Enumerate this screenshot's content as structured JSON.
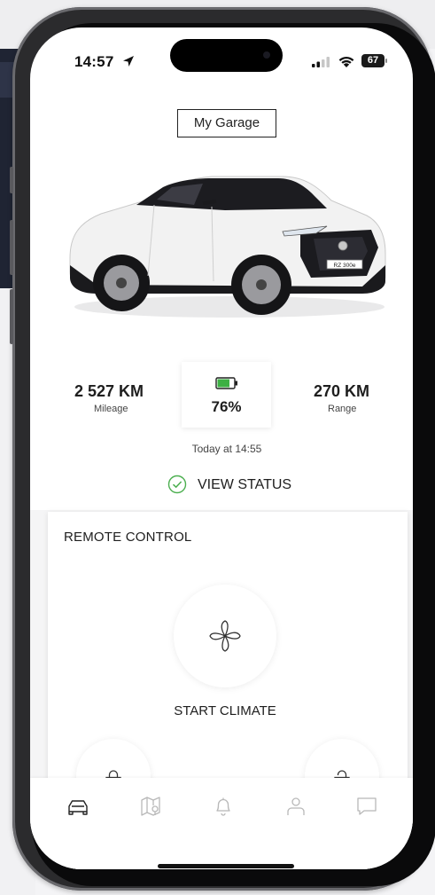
{
  "status_bar": {
    "time": "14:57",
    "battery_level": "67",
    "icons": [
      "location-arrow-icon",
      "signal-icon",
      "wifi-icon",
      "battery-icon"
    ]
  },
  "header": {
    "garage_button_label": "My Garage"
  },
  "vehicle": {
    "mileage_value": "2 527 KM",
    "mileage_label": "Mileage",
    "battery_percent": "76%",
    "range_value": "270 KM",
    "range_label": "Range",
    "updated": "Today at 14:55",
    "view_status_label": "VIEW STATUS",
    "plate": "RZ 300e"
  },
  "remote_control": {
    "title": "REMOTE CONTROL",
    "climate_label": "START CLIMATE"
  },
  "tab_bar": {
    "tabs": [
      {
        "icon": "car-icon",
        "active": true
      },
      {
        "icon": "map-icon",
        "active": false
      },
      {
        "icon": "bell-icon",
        "active": false
      },
      {
        "icon": "profile-icon",
        "active": false
      },
      {
        "icon": "chat-icon",
        "active": false
      }
    ]
  },
  "colors": {
    "battery_green": "#3cb043",
    "check_green": "#4caf50",
    "text": "#1e1e1e",
    "inactive_icon": "#b8b8b8"
  }
}
